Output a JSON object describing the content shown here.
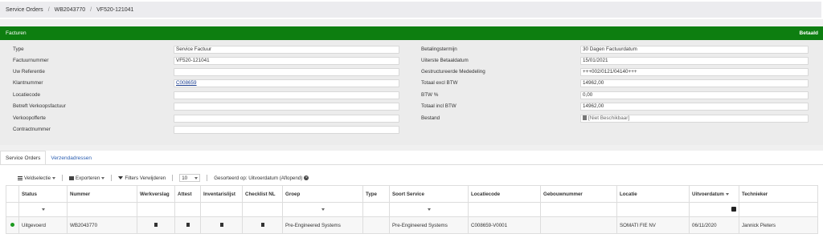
{
  "breadcrumb": {
    "items": [
      "Service Orders",
      "WB2043770",
      "VF520-121041"
    ],
    "separator": "/"
  },
  "card": {
    "title": "Facturen",
    "status": "Betaald",
    "header_color": "#0d7e10",
    "left_fields": [
      {
        "label": "Type",
        "value": "Service Factuur"
      },
      {
        "label": "Factuurnummer",
        "value": "VF520-121041"
      },
      {
        "label": "Uw Referentie",
        "value": ""
      },
      {
        "label": "Klantnummer",
        "value": "C008659"
      },
      {
        "label": "Locatiecode",
        "value": ""
      },
      {
        "label": "Betreft Verkoopsfactuur",
        "value": ""
      },
      {
        "label": "Verkoopofferte",
        "value": ""
      },
      {
        "label": "Contractnummer",
        "value": ""
      }
    ],
    "right_fields": [
      {
        "label": "Betalingstermijn",
        "value": "30 Dagen Factuurdatum"
      },
      {
        "label": "Uiterste Betaaldatum",
        "value": "15/01/2021"
      },
      {
        "label": "Gestructureerde Mededeling",
        "value": "+++002/0121/04140+++"
      },
      {
        "label": "Totaal excl BTW",
        "value": "14962,00"
      },
      {
        "label": "BTW %",
        "value": "0,00"
      },
      {
        "label": "Totaal incl BTW",
        "value": "14962,00"
      },
      {
        "label": "Bestand",
        "value": "[Niet Beschikbaar]"
      }
    ]
  },
  "tabs": [
    {
      "label": "Service Orders",
      "active": true
    },
    {
      "label": "Verzendadressen",
      "active": false
    }
  ],
  "toolbar": {
    "field_selection": "Veldselectie",
    "export": "Exporteren",
    "clear_filters": "Filters Verwijderen",
    "page_size": "10",
    "sort_info": "Gesorteerd op: Uitvoerdatum (Aflopend)"
  },
  "grid": {
    "columns": [
      "Status",
      "Nummer",
      "Werkverslag",
      "Attest",
      "Inventarislijst",
      "Checklist NL",
      "Groep",
      "Type",
      "Soort Service",
      "Locatiecode",
      "Gebouwnummer",
      "Locatie",
      "Uitvoerdatum",
      "Technieker"
    ],
    "sort_column": "Uitvoerdatum",
    "rows": [
      {
        "status": "Uitgevoerd",
        "nummer": "WB2043770",
        "groep": "Pre-Engineered Systems",
        "type": "",
        "soort_service": "Pre-Engineered Systems",
        "locatiecode": "C008659-V0001",
        "gebouwnummer": "",
        "locatie": "SOMATI FIE NV",
        "uitvoerdatum": "06/11/2020",
        "technieker": "Jannick Pieters"
      }
    ]
  },
  "colors": {
    "status_dot": "#1c9a1f",
    "link": "#2a5db0"
  }
}
